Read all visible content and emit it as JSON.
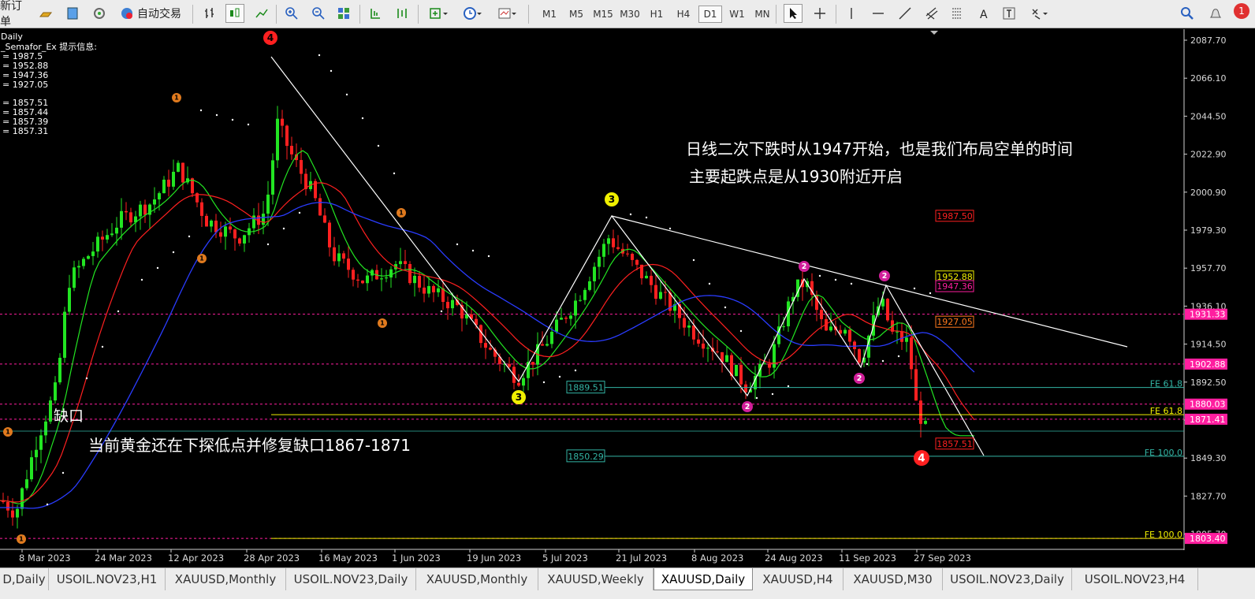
{
  "toolbar": {
    "new_order_label": "新订单",
    "auto_trade_label": "自动交易",
    "timeframes": [
      "M1",
      "M5",
      "M15",
      "M30",
      "H1",
      "H4",
      "D1",
      "W1",
      "MN"
    ],
    "active_timeframe": "D1",
    "notification_count": "1"
  },
  "chart": {
    "symbol_period": "Daily",
    "indicator_title": "_Semafor_Ex 提示信息:",
    "indicator_values": [
      "= 1987.5",
      "= 1952.88",
      "= 1947.36",
      "= 1927.05",
      "= 1857.51",
      "= 1857.44",
      "= 1857.39",
      "= 1857.31"
    ],
    "annotation_top_line1": "日线二次下跌时从1947开始，也是我们布局空单的时间",
    "annotation_top_line2": "主要起跌点是从1930附近开启",
    "annotation_gap": "缺口",
    "annotation_bottom": "当前黄金还在下探低点并修复缺口1867-1871",
    "price_axis": [
      "2087.70",
      "2066.10",
      "2044.50",
      "2022.90",
      "2000.90",
      "1979.30",
      "1957.70",
      "1936.10",
      "1914.50",
      "1892.50",
      "1871.30",
      "1849.30",
      "1827.70",
      "1805.70"
    ],
    "price_tags": [
      {
        "text": "1931.33",
        "color": "#ff1e9f",
        "price": 1931.33
      },
      {
        "text": "1902.88",
        "color": "#ff1e9f",
        "price": 1902.88
      },
      {
        "text": "1880.03",
        "color": "#ff1e9f",
        "price": 1880.03
      },
      {
        "text": "1871.41",
        "color": "#ff1e9f",
        "price": 1871.41
      },
      {
        "text": "1803.40",
        "color": "#ff1e9f",
        "price": 1803.4
      }
    ],
    "level_boxes": [
      {
        "text": "1987.50",
        "color": "#ff2020",
        "price": 1987.5
      },
      {
        "text": "1952.88",
        "color": "#f0f000",
        "price": 1952.88
      },
      {
        "text": "1947.36",
        "color": "#ff1e9f",
        "price": 1947.36
      },
      {
        "text": "1927.05",
        "color": "#ff7a1e",
        "price": 1927.05
      },
      {
        "text": "1857.51",
        "color": "#ff2020",
        "price": 1857.51
      }
    ],
    "fib_boxes": [
      {
        "text": "1889.51",
        "price": 1889.51
      },
      {
        "text": "1850.29",
        "price": 1850.29
      }
    ],
    "fib_labels": [
      {
        "text": "FE 61.8",
        "color": "#33b5a5",
        "price": 1889.5
      },
      {
        "text": "FE 61.8",
        "color": "#f0f000",
        "price": 1874.0
      },
      {
        "text": "FE 100.0",
        "color": "#33b5a5",
        "price": 1850.3
      },
      {
        "text": "FE 100.0",
        "color": "#f0f000",
        "price": 1803.4
      }
    ],
    "date_axis": [
      "8 Mar 2023",
      "24 Mar 2023",
      "12 Apr 2023",
      "28 Apr 2023",
      "16 May 2023",
      "1 Jun 2023",
      "19 Jun 2023",
      "5 Jul 2023",
      "21 Jul 2023",
      "8 Aug 2023",
      "24 Aug 2023",
      "11 Sep 2023",
      "27 Sep 2023"
    ],
    "semafor_points": [
      "4",
      "3",
      "3",
      "2",
      "2",
      "2",
      "2",
      "4",
      "1",
      "1",
      "1",
      "1",
      "1",
      "1"
    ],
    "colors": {
      "bull": "#22e522",
      "bear": "#ff2020",
      "ma_fast": "#22e522",
      "ma_mid": "#ff2020",
      "ma_slow": "#2a3cff",
      "grid_level": "#ff1e9f"
    }
  },
  "tabs": [
    {
      "label": "D,Daily"
    },
    {
      "label": "USOIL.NOV23,H1"
    },
    {
      "label": "XAUUSD,Monthly"
    },
    {
      "label": "USOIL.NOV23,Daily"
    },
    {
      "label": "XAUUSD,Monthly"
    },
    {
      "label": "XAUUSD,Weekly"
    },
    {
      "label": "XAUUSD,Daily"
    },
    {
      "label": "XAUUSD,H4"
    },
    {
      "label": "XAUUSD,M30"
    },
    {
      "label": "USOIL.NOV23,Daily"
    },
    {
      "label": "USOIL.NOV23,H4"
    }
  ],
  "active_tab": "XAUUSD,Daily"
}
